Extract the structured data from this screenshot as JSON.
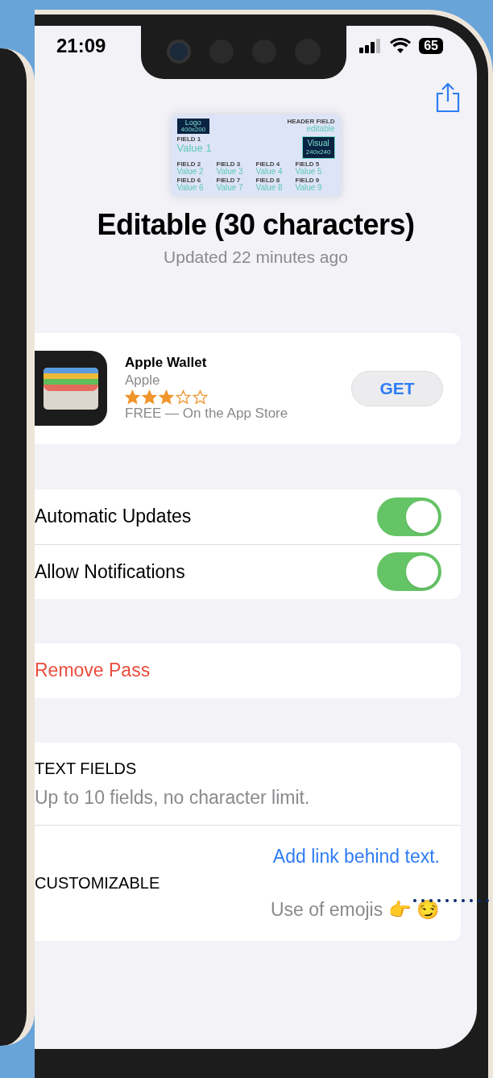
{
  "status_bar": {
    "time": "21:09",
    "battery": "65"
  },
  "pass_preview": {
    "logo": "Logo",
    "logo_size": "400x200",
    "header_label": "HEADER FIELD",
    "header_value": "editable",
    "field1_label": "FIELD 1",
    "field1_value": "Value 1",
    "visual": "Visual",
    "visual_size": "240x240",
    "fields": [
      {
        "label": "FIELD 2",
        "value": "Value 2"
      },
      {
        "label": "FIELD 3",
        "value": "Value 3"
      },
      {
        "label": "FIELD 4",
        "value": "Value 4"
      },
      {
        "label": "FIELD 5",
        "value": "Value 5"
      },
      {
        "label": "FIELD 6",
        "value": "Value 6"
      },
      {
        "label": "FIELD 7",
        "value": "Value 7"
      },
      {
        "label": "FIELD 8",
        "value": "Value 8"
      },
      {
        "label": "FIELD 9",
        "value": "Value 9"
      }
    ]
  },
  "title": "Editable (30 characters)",
  "subtitle": "Updated 22 minutes ago",
  "app": {
    "name": "Apple Wallet",
    "developer": "Apple",
    "stars": 3,
    "price": "FREE — On the App Store",
    "button": "GET"
  },
  "toggles": [
    {
      "label": "Automatic Updates",
      "on": true
    },
    {
      "label": "Allow Notifications",
      "on": true
    }
  ],
  "remove": "Remove Pass",
  "info": {
    "heading": "TEXT FIELDS",
    "text": "Up to 10 fields, no character limit.",
    "heading2": "CUSTOMIZABLE",
    "link": "Add link behind text.",
    "note": "Use of emojis 👉 😏"
  }
}
